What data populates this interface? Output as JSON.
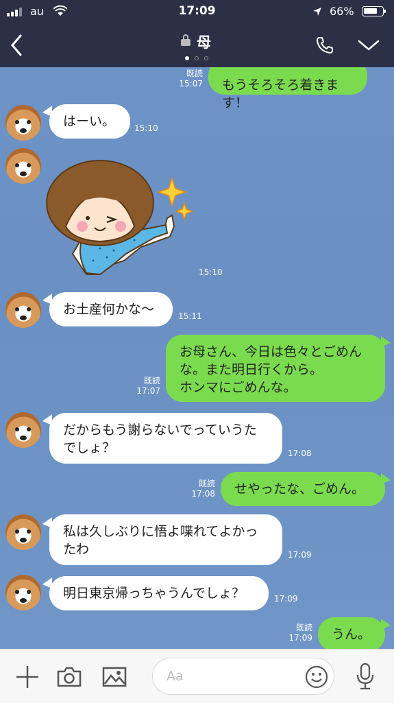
{
  "status": {
    "carrier": "au",
    "time": "17:09",
    "battery": "66%"
  },
  "header": {
    "title": "母",
    "back_icon": "chevron-left-icon",
    "call_icon": "phone-icon",
    "menu_icon": "chevron-down-icon",
    "lock_icon": "lock-icon"
  },
  "messages": [
    {
      "from": "me",
      "lines": [
        "もうそろそろ着きます！"
      ],
      "read": "既読",
      "time": "15:07"
    },
    {
      "from": "mom",
      "lines": [
        "はーい。"
      ],
      "time": "15:10"
    },
    {
      "from": "mom",
      "type": "sticker",
      "time": "15:10"
    },
    {
      "from": "mom",
      "lines": [
        "お土産何かな〜"
      ],
      "time": "15:11"
    },
    {
      "from": "me",
      "lines": [
        "お母さん、今日は色々とごめん",
        "な。また明日行くから。",
        "ホンマにごめんな。"
      ],
      "read": "既読",
      "time": "17:07"
    },
    {
      "from": "mom",
      "lines": [
        "だからもう謝らないでっていうた",
        "でしょ？"
      ],
      "time": "17:08"
    },
    {
      "from": "me",
      "lines": [
        "せやったな、ごめん。"
      ],
      "read": "既読",
      "time": "17:08"
    },
    {
      "from": "mom",
      "lines": [
        "私は久しぶりに悟よ喋れてよかっ",
        "たわ"
      ],
      "time": "17:09"
    },
    {
      "from": "mom",
      "lines": [
        "明日東京帰っちゃうんでしょ？"
      ],
      "time": "17:09"
    },
    {
      "from": "me",
      "lines": [
        "うん。"
      ],
      "read": "既読",
      "time": "17:09"
    }
  ],
  "input": {
    "placeholder": "Aa"
  },
  "colors": {
    "header_bg": "#2b3047",
    "my_bubble": "#7bdb4f",
    "chat_bg": "#6b90c4"
  }
}
